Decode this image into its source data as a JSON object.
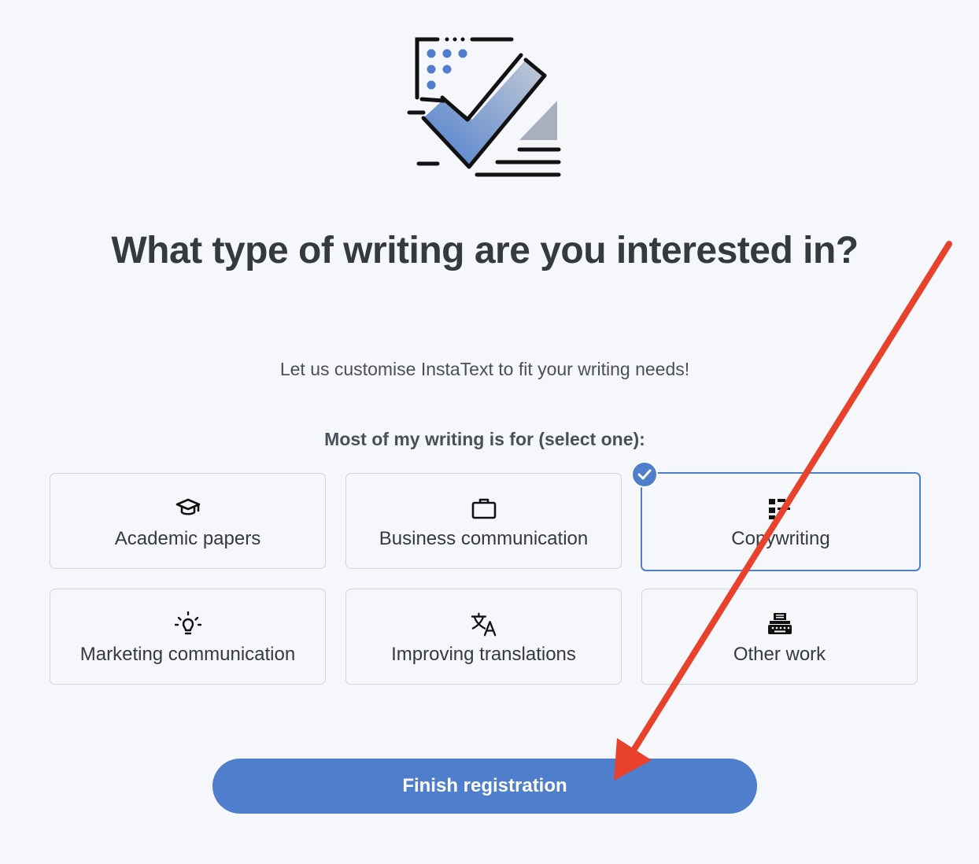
{
  "header": {
    "title": "What type of writing are you interested in?",
    "subtitle": "Let us customise InstaText to fit your writing needs!"
  },
  "selection": {
    "prompt": "Most of my writing is for (select one):",
    "selected": "Copywriting",
    "options": [
      {
        "label": "Academic papers",
        "icon": "graduation-cap-icon"
      },
      {
        "label": "Business communication",
        "icon": "briefcase-icon"
      },
      {
        "label": "Copywriting",
        "icon": "copywriting-icon"
      },
      {
        "label": "Marketing communication",
        "icon": "lightbulb-icon"
      },
      {
        "label": "Improving translations",
        "icon": "translate-icon"
      },
      {
        "label": "Other work",
        "icon": "typewriter-icon"
      }
    ]
  },
  "actions": {
    "finish_label": "Finish registration"
  },
  "colors": {
    "accent": "#4f7fcc",
    "annotation_arrow": "#e8412c",
    "background": "#f6f7fb",
    "text": "#343a40"
  }
}
